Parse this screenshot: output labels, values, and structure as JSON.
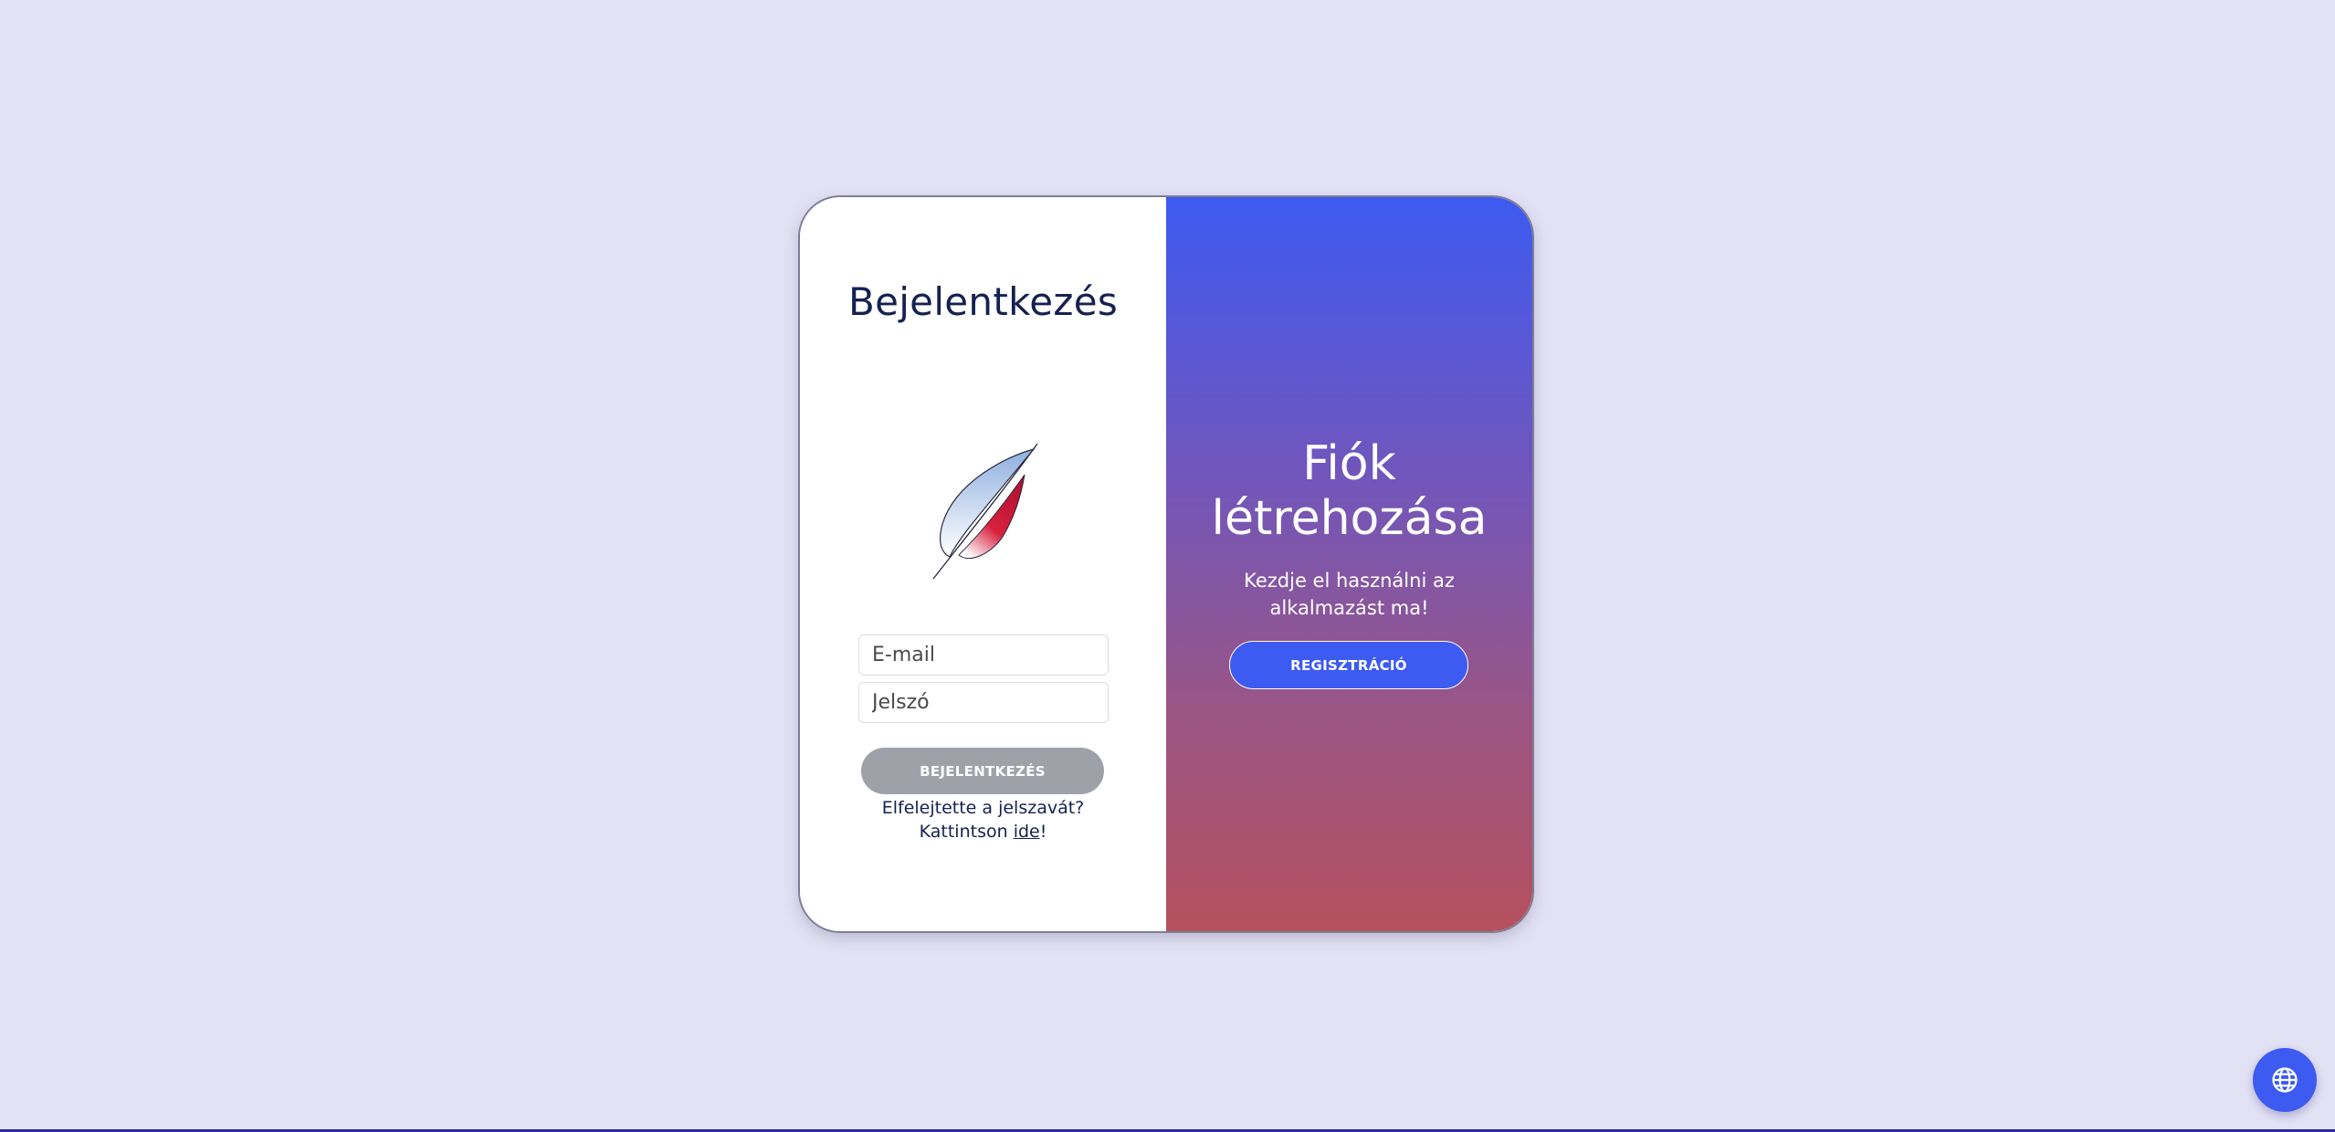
{
  "login": {
    "title": "Bejelentkezés",
    "email_placeholder": "E-mail",
    "password_placeholder": "Jelszó",
    "submit_label": "BEJELENTKEZÉS",
    "forgot_line1": "Elfelejtette a jelszavát?",
    "forgot_prefix": "Kattintson ",
    "forgot_link": "ide",
    "forgot_suffix": "!"
  },
  "register": {
    "title_line1": "Fiók",
    "title_line2": "létrehozása",
    "subtitle_line1": "Kezdje el használni az",
    "subtitle_line2": "alkalmazást ma!",
    "button_label": "REGISZTRÁCIÓ"
  },
  "icons": {
    "logo": "feather-logo",
    "language": "globe-icon"
  },
  "colors": {
    "background": "#e3e2f5",
    "accent": "#3d5af1",
    "title_text": "#152150",
    "disabled_button": "#9ea2a8",
    "gradient_bottom": "#b6515e"
  }
}
